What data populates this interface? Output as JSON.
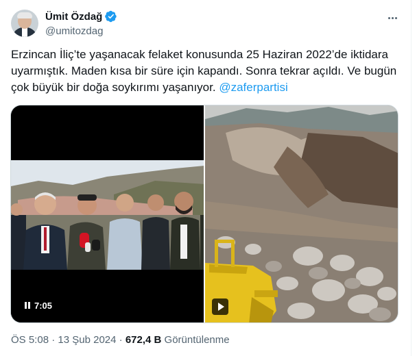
{
  "author": {
    "name": "Ümit Özdağ",
    "handle": "@umitozdag",
    "verified": true,
    "avatar_icon": "profile-photo"
  },
  "tweet": {
    "text": "Erzincan İliç’te yaşanacak felaket konusunda 25 Haziran 2022’de iktidara uyarmıştık. Maden kısa bir süre için kapandı. Sonra tekrar açıldı. Ve bugün çok büyük bir doğa soykırımı yaşanıyor.",
    "mention": "@zaferpartisi"
  },
  "media": {
    "video": {
      "duration": "7:05"
    },
    "image_video": {
      "icon": "play-icon"
    }
  },
  "footer": {
    "time": "ÖS 5:08",
    "separator": "·",
    "date": "13 Şub 2024",
    "views_count": "672,4 B",
    "views_label": "Görüntülenme"
  },
  "colors": {
    "link": "#1d9bf0",
    "verified": "#1d9bf0",
    "secondary_text": "#536471"
  }
}
